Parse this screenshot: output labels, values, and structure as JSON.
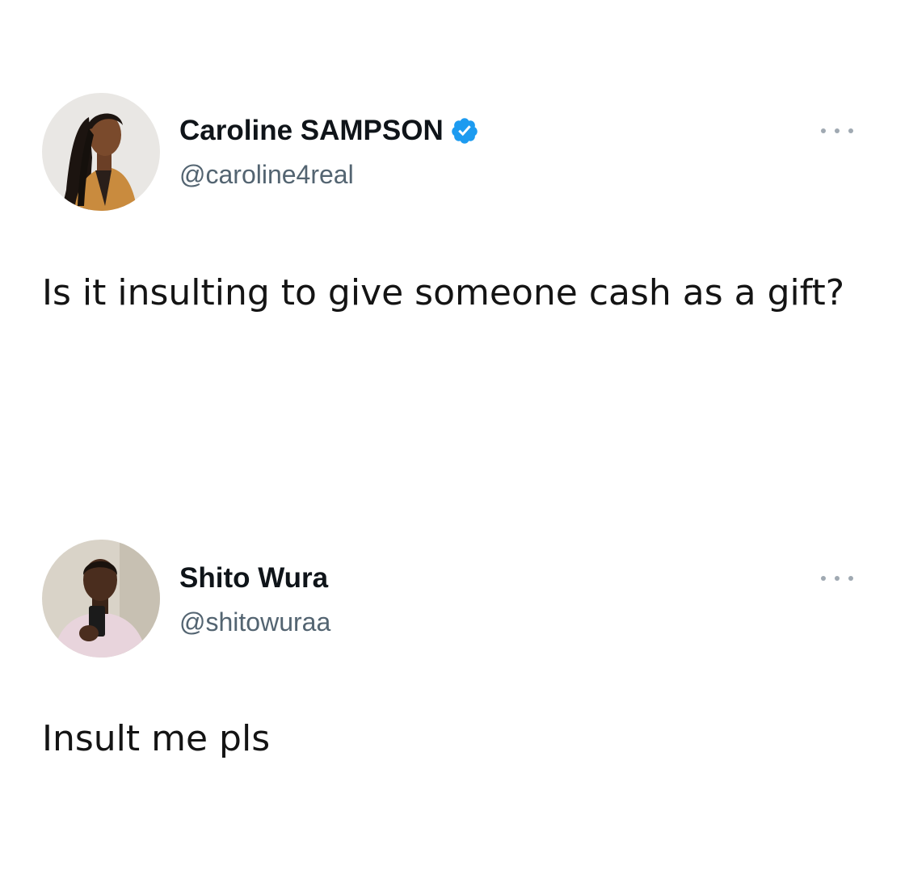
{
  "tweets": [
    {
      "author": {
        "name": "Caroline SAMPSON",
        "handle": "@caroline4real",
        "verified": true,
        "avatar_icon": "woman-portrait-avatar"
      },
      "text": "Is it insulting to give someone cash as a gift?",
      "more_icon": "more-options-icon"
    },
    {
      "author": {
        "name": "Shito Wura",
        "handle": "@shitowuraa",
        "verified": false,
        "avatar_icon": "man-selfie-avatar"
      },
      "text": "Insult me pls",
      "more_icon": "more-options-icon"
    }
  ],
  "colors": {
    "verified_badge": "#1d9bf0",
    "handle": "#536471",
    "text": "#141414"
  }
}
